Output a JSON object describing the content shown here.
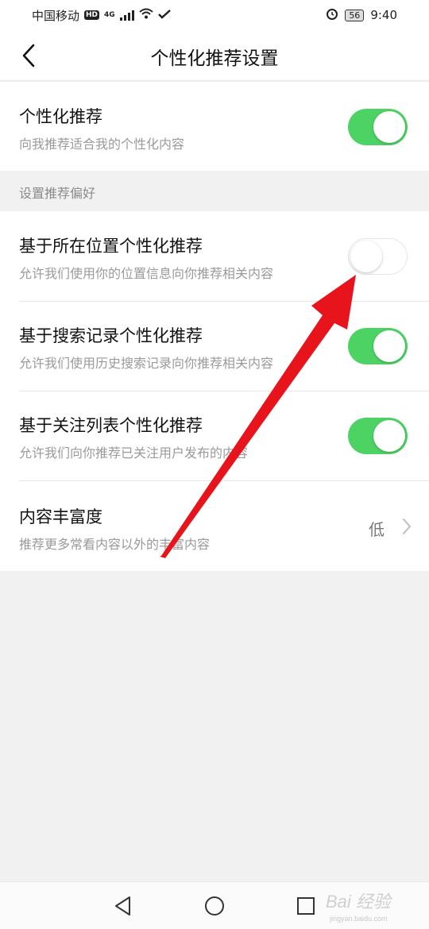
{
  "status_bar": {
    "carrier": "中国移动",
    "hd_badge": "HD",
    "network": "4G",
    "battery": "56",
    "time": "9:40"
  },
  "header": {
    "title": "个性化推荐设置"
  },
  "main_toggle": {
    "label": "个性化推荐",
    "description": "向我推荐适合我的个性化内容",
    "enabled": true
  },
  "section": {
    "label": "设置推荐偏好"
  },
  "preferences": [
    {
      "label": "基于所在位置个性化推荐",
      "description": "允许我们使用你的位置信息向你推荐相关内容",
      "enabled": false
    },
    {
      "label": "基于搜索记录个性化推荐",
      "description": "允许我们使用历史搜索记录向你推荐相关内容",
      "enabled": true
    },
    {
      "label": "基于关注列表个性化推荐",
      "description": "允许我们向你推荐已关注用户发布的内容",
      "enabled": true
    }
  ],
  "richness": {
    "label": "内容丰富度",
    "description": "推荐更多常看内容以外的丰富内容",
    "value": "低"
  },
  "watermark": {
    "brand": "Bai 经验",
    "url": "jingyan.baidu.com"
  },
  "colors": {
    "toggle_on": "#4dd364",
    "annotation_arrow": "#e8141b"
  }
}
